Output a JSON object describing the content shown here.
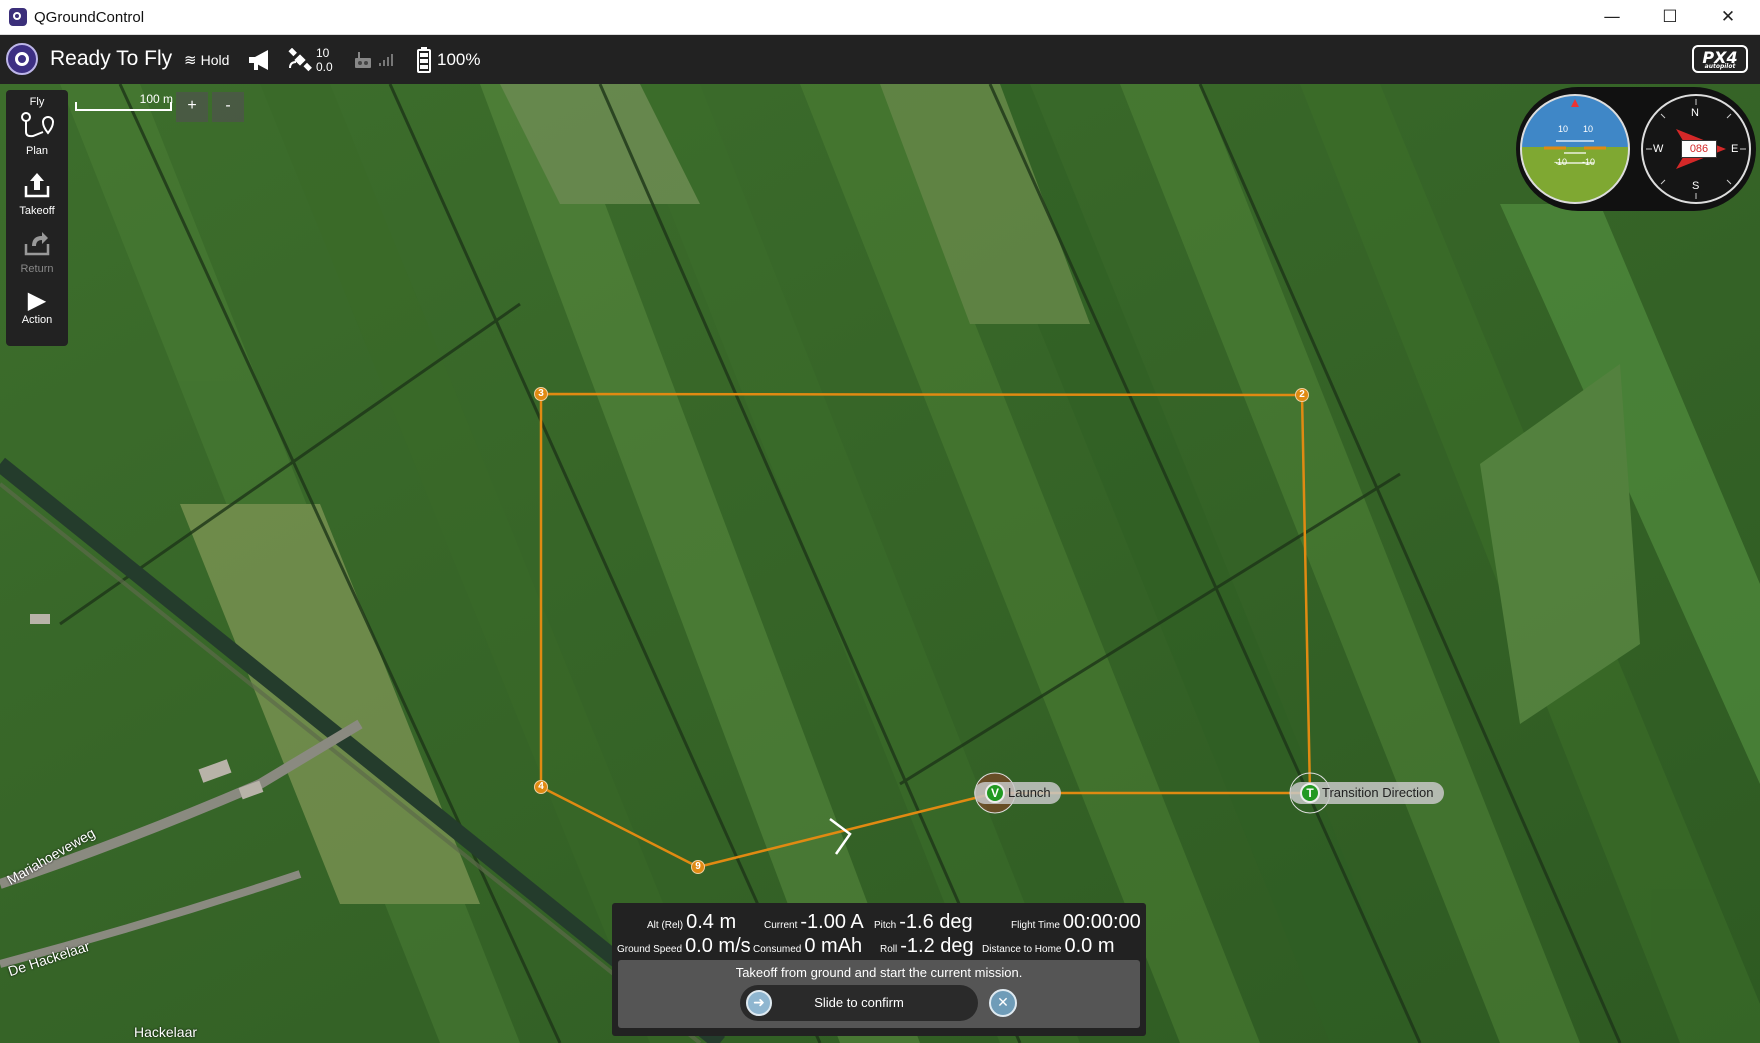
{
  "window": {
    "title": "QGroundControl",
    "minimize": "—",
    "maximize": "☐",
    "close": "✕"
  },
  "toolbar": {
    "status": "Ready To Fly",
    "mode": "Hold",
    "gps_count": "10",
    "gps_hdop": "0.0",
    "battery": "100%",
    "brand": "PX4",
    "brand_sub": "autopilot"
  },
  "toolstrip": {
    "header": "Fly",
    "items": [
      {
        "label": "Plan",
        "icon": "plan-icon",
        "glyph": "⟟"
      },
      {
        "label": "Takeoff",
        "icon": "takeoff-icon",
        "glyph": "⇧"
      },
      {
        "label": "Return",
        "icon": "return-icon",
        "glyph": "↶"
      },
      {
        "label": "Action",
        "icon": "action-icon",
        "glyph": "▶"
      }
    ]
  },
  "map": {
    "scale": "100 m",
    "zoom_in": "+",
    "zoom_out": "-",
    "waypoints": [
      "3",
      "2",
      "4",
      "9"
    ],
    "launch_label": "Launch",
    "launch_marker": "V",
    "transition_label": "Transition Direction",
    "transition_marker": "T",
    "roads": [
      "Mariahoeveweg",
      "De Hackelaar",
      "Hackelaar"
    ]
  },
  "instruments": {
    "attitude_ticks": [
      "10",
      "10",
      "-10",
      "-10"
    ],
    "heading": "086",
    "compass": {
      "n": "N",
      "e": "E",
      "s": "S",
      "w": "W"
    }
  },
  "telemetry": {
    "alt_label": "Alt (Rel)",
    "alt_value": "0.4 m",
    "current_label": "Current",
    "current_value": "-1.00 A",
    "pitch_label": "Pitch",
    "pitch_value": "-1.6 deg",
    "flight_time_label": "Flight Time",
    "flight_time_value": "00:00:00",
    "ground_speed_label": "Ground Speed",
    "ground_speed_value": "0.0 m/s",
    "consumed_label": "Consumed",
    "consumed_value": "0 mAh",
    "roll_label": "Roll",
    "roll_value": "-1.2 deg",
    "distance_home_label": "Distance to Home",
    "distance_home_value": "0.0 m"
  },
  "confirm": {
    "message": "Takeoff from ground and start the current mission.",
    "slider_text": "Slide to confirm",
    "cancel": "✕"
  },
  "colors": {
    "mission_path": "#e08a12",
    "toolbar_bg": "#222222",
    "field_green": "#2f5a22"
  }
}
